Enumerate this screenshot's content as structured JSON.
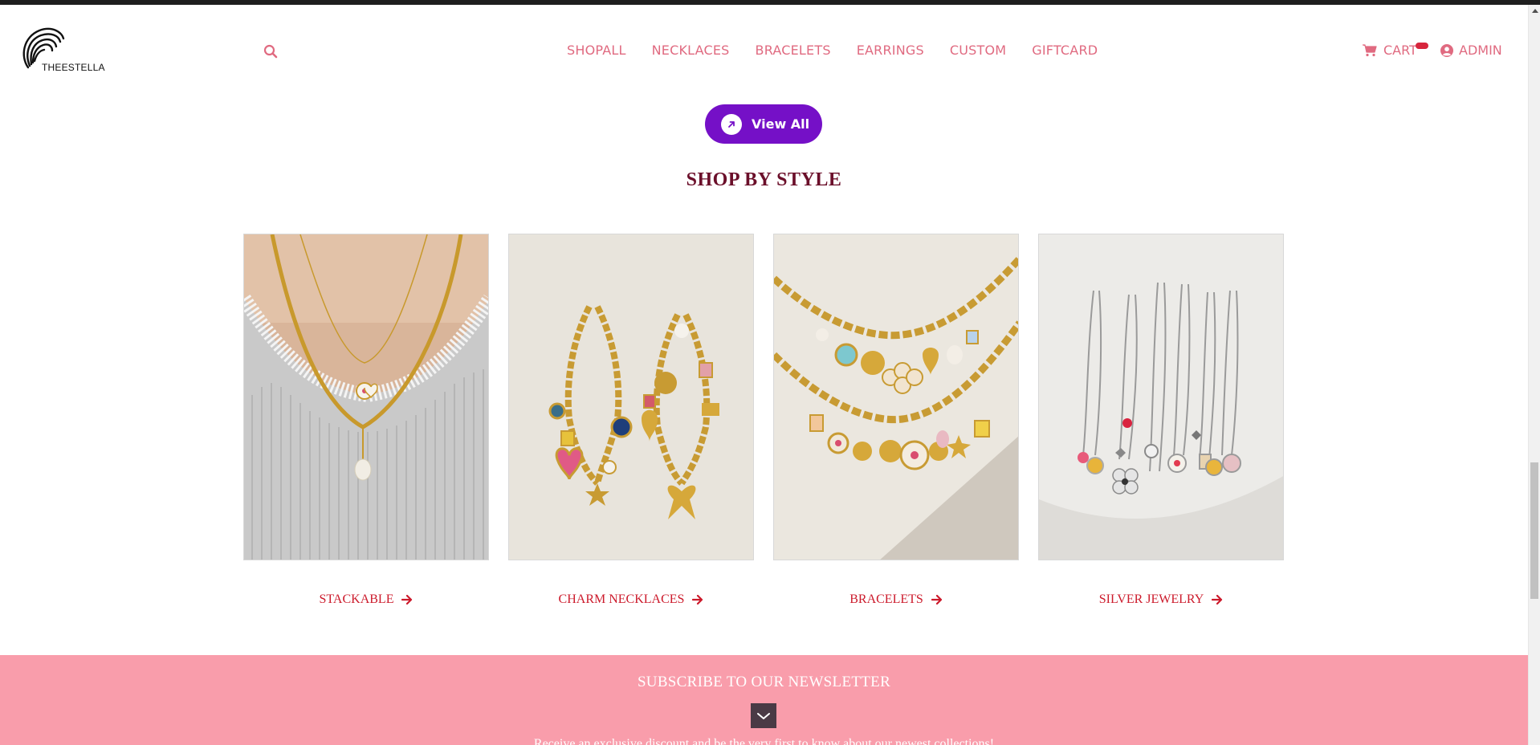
{
  "brand": {
    "name": "THEESTELLA"
  },
  "nav": {
    "items": [
      "SHOPALL",
      "NECKLACES",
      "BRACELETS",
      "EARRINGS",
      "CUSTOM",
      "GIFTCARD"
    ]
  },
  "header": {
    "cart_label": "CART",
    "admin_label": "ADMIN"
  },
  "view_all": {
    "label": "View All"
  },
  "section": {
    "title": "SHOP BY STYLE"
  },
  "categories": [
    {
      "label": "STACKABLE",
      "image": "necklace-on-model-photo"
    },
    {
      "label": "CHARM NECKLACES",
      "image": "gold-charm-chains-photo"
    },
    {
      "label": "BRACELETS",
      "image": "gold-charm-bracelets-photo"
    },
    {
      "label": "SILVER JEWELRY",
      "image": "silver-charm-necklaces-photo"
    }
  ],
  "newsletter": {
    "title": "SUBSCRIBE TO OUR NEWSLETTER",
    "description": "Receive an exclusive discount and be the very first to know about our newest collections!"
  },
  "colors": {
    "nav": "#e06a80",
    "view_all_bg": "#7510c7",
    "section_title": "#6b0f2a",
    "category_label": "#cc1a2b",
    "newsletter_bg": "#f99dab",
    "cart_badge": "#d7263d"
  }
}
